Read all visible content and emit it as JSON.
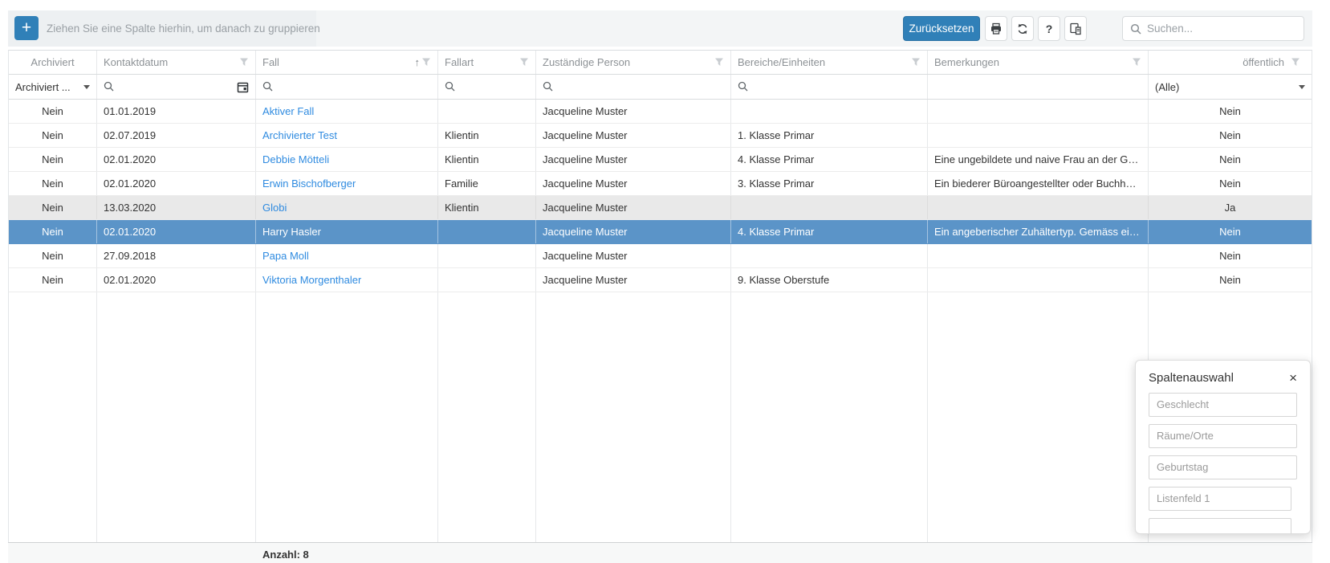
{
  "toolbar": {
    "add_button": "+",
    "group_hint": "Ziehen Sie eine Spalte hierhin, um danach zu gruppieren",
    "reset_label": "Zurücksetzen",
    "help_label": "?",
    "icon_buttons": [
      "print-icon",
      "refresh-icon",
      "help-icon",
      "column-chooser-icon"
    ],
    "search_placeholder": "Suchen..."
  },
  "grid": {
    "sort_indicator": "↑",
    "columns": [
      {
        "label": "Archiviert",
        "filter_icon": false,
        "sorted": false
      },
      {
        "label": "Kontaktdatum",
        "filter_icon": true,
        "sorted": false
      },
      {
        "label": "Fall",
        "filter_icon": true,
        "sorted": true
      },
      {
        "label": "Fallart",
        "filter_icon": true,
        "sorted": false
      },
      {
        "label": "Zuständige Person",
        "filter_icon": true,
        "sorted": false
      },
      {
        "label": "Bereiche/Einheiten",
        "filter_icon": true,
        "sorted": false
      },
      {
        "label": "Bemerkungen",
        "filter_icon": true,
        "sorted": false
      },
      {
        "label": "öffentlich",
        "filter_icon": true,
        "sorted": false
      }
    ],
    "filter_row": {
      "archiviert_value": "Archiviert ...",
      "oeffentlich_value": "(Alle)"
    },
    "rows": [
      {
        "archiviert": "Nein",
        "kontaktdatum": "01.01.2019",
        "fall": "Aktiver Fall",
        "fallart": "",
        "person": "Jacqueline Muster",
        "bereiche": "",
        "bemerkungen": "",
        "oeffentlich": "Nein"
      },
      {
        "archiviert": "Nein",
        "kontaktdatum": "02.07.2019",
        "fall": "Archivierter Test",
        "fallart": "Klientin",
        "person": "Jacqueline Muster",
        "bereiche": "1. Klasse Primar",
        "bemerkungen": "",
        "oeffentlich": "Nein"
      },
      {
        "archiviert": "Nein",
        "kontaktdatum": "02.01.2020",
        "fall": "Debbie Mötteli",
        "fallart": "Klientin",
        "person": "Jacqueline Muster",
        "bereiche": "4. Klasse Primar",
        "bemerkungen": "Eine ungebildete und naive Frau an der Grenz...",
        "oeffentlich": "Nein"
      },
      {
        "archiviert": "Nein",
        "kontaktdatum": "02.01.2020",
        "fall": "Erwin Bischofberger",
        "fallart": "Familie",
        "person": "Jacqueline Muster",
        "bereiche": "3. Klasse Primar",
        "bemerkungen": "Ein biederer Büroangestellter oder Buchhalte...",
        "oeffentlich": "Nein"
      },
      {
        "archiviert": "Nein",
        "kontaktdatum": "13.03.2020",
        "fall": "Globi",
        "fallart": "Klientin",
        "person": "Jacqueline Muster",
        "bereiche": "",
        "bemerkungen": "",
        "oeffentlich": "Ja"
      },
      {
        "archiviert": "Nein",
        "kontaktdatum": "02.01.2020",
        "fall": "Harry Hasler",
        "fallart": "",
        "person": "Jacqueline Muster",
        "bereiche": "4. Klasse Primar",
        "bemerkungen": "Ein angeberischer Zuhältertyp. Gemäss eigen...",
        "oeffentlich": "Nein"
      },
      {
        "archiviert": "Nein",
        "kontaktdatum": "27.09.2018",
        "fall": "Papa Moll",
        "fallart": "",
        "person": "Jacqueline Muster",
        "bereiche": "",
        "bemerkungen": "",
        "oeffentlich": "Nein"
      },
      {
        "archiviert": "Nein",
        "kontaktdatum": "02.01.2020",
        "fall": "Viktoria Morgenthaler",
        "fallart": "",
        "person": "Jacqueline Muster",
        "bereiche": "9. Klasse Oberstufe",
        "bemerkungen": "",
        "oeffentlich": "Nein"
      }
    ]
  },
  "popup": {
    "title": "Spaltenauswahl",
    "close_label": "×",
    "items": [
      "Geschlecht",
      "Räume/Orte",
      "Geburtstag",
      "Listenfeld 1"
    ]
  },
  "footer": {
    "count_label": "Anzahl: 8"
  },
  "colors": {
    "accent_blue": "#3080b8",
    "selected_row": "#5b94c8",
    "hover_row": "#e9e9e9",
    "link_blue": "#2f8be0",
    "header_text": "#8d9296",
    "toolbar_bg": "#f3f5f6",
    "group_panel_bg": "#edf0f2"
  }
}
